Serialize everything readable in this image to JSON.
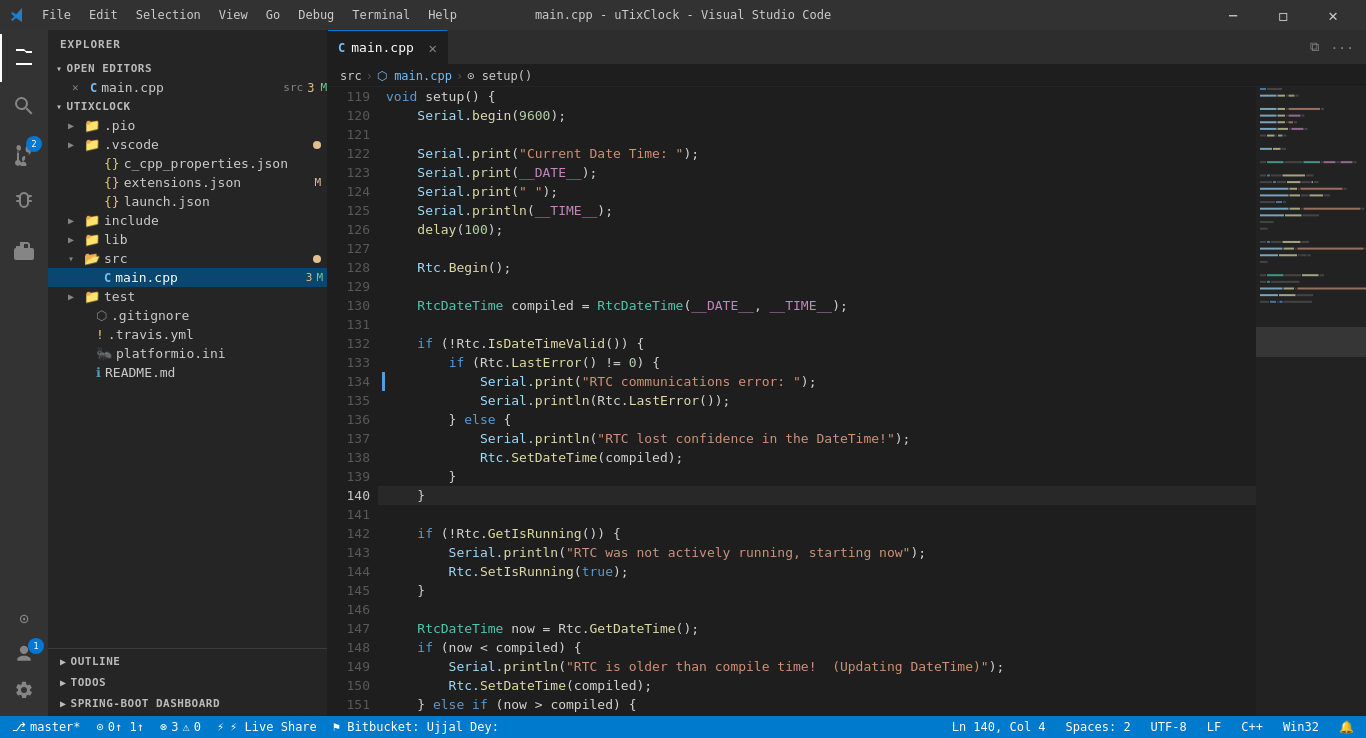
{
  "titleBar": {
    "title": "main.cpp - uTixClock - Visual Studio Code",
    "menuItems": [
      "File",
      "Edit",
      "Selection",
      "View",
      "Go",
      "Debug",
      "Terminal",
      "Help"
    ],
    "controls": [
      "minimize",
      "restore",
      "close"
    ]
  },
  "activityBar": {
    "items": [
      {
        "name": "explorer",
        "icon": "⎘",
        "active": true
      },
      {
        "name": "search",
        "icon": "🔍"
      },
      {
        "name": "source-control",
        "icon": "⑂",
        "badge": "2"
      },
      {
        "name": "debug",
        "icon": "▷"
      },
      {
        "name": "extensions",
        "icon": "⊞"
      }
    ],
    "bottomItems": [
      {
        "name": "remote-explorer",
        "icon": "⊙"
      },
      {
        "name": "accounts",
        "icon": "👤",
        "badge": "1"
      },
      {
        "name": "settings",
        "icon": "⚙"
      }
    ]
  },
  "sidebar": {
    "title": "EXPLORER",
    "sections": {
      "openEditors": {
        "label": "OPEN EDITORS",
        "items": [
          {
            "name": "main.cpp",
            "icon": "C",
            "iconColor": "#75bef8",
            "path": "src",
            "badge": "3",
            "badgeLabel": "M",
            "modified": true
          }
        ]
      },
      "project": {
        "label": "UTIXCLOCK",
        "items": [
          {
            "name": ".pio",
            "type": "folder",
            "indent": 1
          },
          {
            "name": ".vscode",
            "type": "folder",
            "indent": 1,
            "dot": true,
            "dotColor": "#e2c08d"
          },
          {
            "name": "c_cpp_properties.json",
            "type": "json",
            "indent": 2
          },
          {
            "name": "extensions.json",
            "type": "json",
            "indent": 2,
            "badge": "M"
          },
          {
            "name": "launch.json",
            "type": "json",
            "indent": 2
          },
          {
            "name": "include",
            "type": "folder",
            "indent": 1
          },
          {
            "name": "lib",
            "type": "folder",
            "indent": 1
          },
          {
            "name": "src",
            "type": "folder",
            "indent": 1,
            "dot": true,
            "dotColor": "#e2c08d"
          },
          {
            "name": "main.cpp",
            "type": "cpp",
            "indent": 2,
            "badge": "3",
            "badgeLabel": "M",
            "modified": true,
            "active": true
          },
          {
            "name": "test",
            "type": "folder",
            "indent": 1
          },
          {
            "name": ".gitignore",
            "type": "file",
            "indent": 1
          },
          {
            "name": ".travis.yml",
            "type": "yaml",
            "indent": 1
          },
          {
            "name": "platformio.ini",
            "type": "ini",
            "indent": 1
          },
          {
            "name": "README.md",
            "type": "md",
            "indent": 1
          }
        ]
      }
    },
    "bottomSections": [
      "OUTLINE",
      "TODOS",
      "SPRING-BOOT DASHBOARD"
    ]
  },
  "tabs": [
    {
      "name": "main.cpp",
      "icon": "C",
      "iconColor": "#75bef8",
      "active": true,
      "modified": false
    }
  ],
  "breadcrumb": {
    "items": [
      "src",
      "main.cpp",
      "setup()"
    ]
  },
  "editor": {
    "lines": [
      {
        "num": 119,
        "content": "void setup() {",
        "tokens": [
          {
            "text": "void",
            "class": "kw"
          },
          {
            "text": " setup() {",
            "class": "op"
          }
        ]
      },
      {
        "num": 120,
        "content": "    Serial.begin(9600);",
        "tokens": [
          {
            "text": "    Serial.",
            "class": "var"
          },
          {
            "text": "begin",
            "class": "fn"
          },
          {
            "text": "(",
            "class": "op"
          },
          {
            "text": "9600",
            "class": "num"
          },
          {
            "text": ");",
            "class": "op"
          }
        ]
      },
      {
        "num": 121,
        "content": ""
      },
      {
        "num": 122,
        "content": "    Serial.print(\"Current Date Time: \");",
        "tokens": [
          {
            "text": "    Serial.",
            "class": "var"
          },
          {
            "text": "print",
            "class": "fn"
          },
          {
            "text": "(",
            "class": "op"
          },
          {
            "text": "\"Current Date Time: \"",
            "class": "str"
          },
          {
            "text": ");",
            "class": "op"
          }
        ]
      },
      {
        "num": 123,
        "content": "    Serial.print(__DATE__);",
        "tokens": [
          {
            "text": "    Serial.",
            "class": "var"
          },
          {
            "text": "print",
            "class": "fn"
          },
          {
            "text": "(",
            "class": "op"
          },
          {
            "text": "__DATE__",
            "class": "macro"
          },
          {
            "text": ");",
            "class": "op"
          }
        ]
      },
      {
        "num": 124,
        "content": "    Serial.print(\" \");",
        "tokens": [
          {
            "text": "    Serial.",
            "class": "var"
          },
          {
            "text": "print",
            "class": "fn"
          },
          {
            "text": "(",
            "class": "op"
          },
          {
            "text": "\" \"",
            "class": "str"
          },
          {
            "text": ");",
            "class": "op"
          }
        ]
      },
      {
        "num": 125,
        "content": "    Serial.println(__TIME__);",
        "tokens": [
          {
            "text": "    Serial.",
            "class": "var"
          },
          {
            "text": "println",
            "class": "fn"
          },
          {
            "text": "(",
            "class": "op"
          },
          {
            "text": "__TIME__",
            "class": "macro"
          },
          {
            "text": ");",
            "class": "op"
          }
        ]
      },
      {
        "num": 126,
        "content": "    delay(100);",
        "tokens": [
          {
            "text": "    ",
            "class": ""
          },
          {
            "text": "delay",
            "class": "fn"
          },
          {
            "text": "(",
            "class": "op"
          },
          {
            "text": "100",
            "class": "num"
          },
          {
            "text": ");",
            "class": "op"
          }
        ]
      },
      {
        "num": 127,
        "content": ""
      },
      {
        "num": 128,
        "content": "    Rtc.Begin();",
        "tokens": [
          {
            "text": "    Rtc.",
            "class": "var"
          },
          {
            "text": "Begin",
            "class": "fn"
          },
          {
            "text": "();",
            "class": "op"
          }
        ]
      },
      {
        "num": 129,
        "content": ""
      },
      {
        "num": 130,
        "content": "    RtcDateTime compiled = RtcDateTime(__DATE__, __TIME__);",
        "tokens": [
          {
            "text": "    ",
            "class": ""
          },
          {
            "text": "RtcDateTime",
            "class": "type"
          },
          {
            "text": " compiled = ",
            "class": "op"
          },
          {
            "text": "RtcDateTime",
            "class": "type"
          },
          {
            "text": "(",
            "class": "op"
          },
          {
            "text": "__DATE__",
            "class": "macro"
          },
          {
            "text": ", ",
            "class": "op"
          },
          {
            "text": "__TIME__",
            "class": "macro"
          },
          {
            "text": ");",
            "class": "op"
          }
        ]
      },
      {
        "num": 131,
        "content": ""
      },
      {
        "num": 132,
        "content": "    if (!Rtc.IsDateTimeValid()) {",
        "tokens": [
          {
            "text": "    ",
            "class": ""
          },
          {
            "text": "if",
            "class": "kw"
          },
          {
            "text": " (!Rtc.",
            "class": "op"
          },
          {
            "text": "IsDateTimeValid",
            "class": "fn"
          },
          {
            "text": "()) {",
            "class": "op"
          }
        ]
      },
      {
        "num": 133,
        "content": "        if (Rtc.LastError() != 0) {",
        "tokens": [
          {
            "text": "        ",
            "class": ""
          },
          {
            "text": "if",
            "class": "kw"
          },
          {
            "text": " (Rtc.",
            "class": "op"
          },
          {
            "text": "LastError",
            "class": "fn"
          },
          {
            "text": "() != ",
            "class": "op"
          },
          {
            "text": "0",
            "class": "num"
          },
          {
            "text": ") {",
            "class": "op"
          }
        ]
      },
      {
        "num": 134,
        "content": "            Serial.print(\"RTC communications error: \");",
        "tokens": [
          {
            "text": "            Serial.",
            "class": "var"
          },
          {
            "text": "print",
            "class": "fn"
          },
          {
            "text": "(",
            "class": "op"
          },
          {
            "text": "\"RTC communications error: \"",
            "class": "str"
          },
          {
            "text": ");",
            "class": "op"
          }
        ],
        "hasIndicator": true
      },
      {
        "num": 135,
        "content": "            Serial.println(Rtc.LastError());",
        "tokens": [
          {
            "text": "            Serial.",
            "class": "var"
          },
          {
            "text": "println",
            "class": "fn"
          },
          {
            "text": "(Rtc.",
            "class": "op"
          },
          {
            "text": "LastError",
            "class": "fn"
          },
          {
            "text": "());",
            "class": "op"
          }
        ]
      },
      {
        "num": 136,
        "content": "        } else {",
        "tokens": [
          {
            "text": "        } ",
            "class": "op"
          },
          {
            "text": "else",
            "class": "kw"
          },
          {
            "text": " {",
            "class": "op"
          }
        ]
      },
      {
        "num": 137,
        "content": "            Serial.println(\"RTC lost confidence in the DateTime!\");",
        "tokens": [
          {
            "text": "            Serial.",
            "class": "var"
          },
          {
            "text": "println",
            "class": "fn"
          },
          {
            "text": "(",
            "class": "op"
          },
          {
            "text": "\"RTC lost confidence in the DateTime!\"",
            "class": "str"
          },
          {
            "text": ");",
            "class": "op"
          }
        ]
      },
      {
        "num": 138,
        "content": "            Rtc.SetDateTime(compiled);",
        "tokens": [
          {
            "text": "            Rtc.",
            "class": "var"
          },
          {
            "text": "SetDateTime",
            "class": "fn"
          },
          {
            "text": "(compiled);",
            "class": "op"
          }
        ]
      },
      {
        "num": 139,
        "content": "        }",
        "tokens": [
          {
            "text": "        }",
            "class": "op"
          }
        ]
      },
      {
        "num": 140,
        "content": "    }",
        "tokens": [
          {
            "text": "    }",
            "class": "op"
          }
        ],
        "current": true
      },
      {
        "num": 141,
        "content": ""
      },
      {
        "num": 142,
        "content": "    if (!Rtc.GetIsRunning()) {",
        "tokens": [
          {
            "text": "    ",
            "class": ""
          },
          {
            "text": "if",
            "class": "kw"
          },
          {
            "text": " (!Rtc.",
            "class": "op"
          },
          {
            "text": "GetIsRunning",
            "class": "fn"
          },
          {
            "text": "()) {",
            "class": "op"
          }
        ]
      },
      {
        "num": 143,
        "content": "        Serial.println(\"RTC was not actively running, starting now\");",
        "tokens": [
          {
            "text": "        Serial.",
            "class": "var"
          },
          {
            "text": "println",
            "class": "fn"
          },
          {
            "text": "(",
            "class": "op"
          },
          {
            "text": "\"RTC was not actively running, starting now\"",
            "class": "str"
          },
          {
            "text": ");",
            "class": "op"
          }
        ]
      },
      {
        "num": 144,
        "content": "        Rtc.SetIsRunning(true);",
        "tokens": [
          {
            "text": "        Rtc.",
            "class": "var"
          },
          {
            "text": "SetIsRunning",
            "class": "fn"
          },
          {
            "text": "(",
            "class": "op"
          },
          {
            "text": "true",
            "class": "bool-val"
          },
          {
            "text": ");",
            "class": "op"
          }
        ]
      },
      {
        "num": 145,
        "content": "    }",
        "tokens": [
          {
            "text": "    }",
            "class": "op"
          }
        ]
      },
      {
        "num": 146,
        "content": ""
      },
      {
        "num": 147,
        "content": "    RtcDateTime now = Rtc.GetDateTime();",
        "tokens": [
          {
            "text": "    ",
            "class": ""
          },
          {
            "text": "RtcDateTime",
            "class": "type"
          },
          {
            "text": " now = Rtc.",
            "class": "op"
          },
          {
            "text": "GetDateTime",
            "class": "fn"
          },
          {
            "text": "();",
            "class": "op"
          }
        ]
      },
      {
        "num": 148,
        "content": "    if (now < compiled) {",
        "tokens": [
          {
            "text": "    ",
            "class": ""
          },
          {
            "text": "if",
            "class": "kw"
          },
          {
            "text": " (now < compiled) {",
            "class": "op"
          }
        ]
      },
      {
        "num": 149,
        "content": "        Serial.println(\"RTC is older than compile time!  (Updating DateTime)\");",
        "tokens": [
          {
            "text": "        Serial.",
            "class": "var"
          },
          {
            "text": "println",
            "class": "fn"
          },
          {
            "text": "(",
            "class": "op"
          },
          {
            "text": "\"RTC is older than compile time!  (Updating DateTime)\"",
            "class": "str"
          },
          {
            "text": ");",
            "class": "op"
          }
        ]
      },
      {
        "num": 150,
        "content": "        Rtc.SetDateTime(compiled);",
        "tokens": [
          {
            "text": "        Rtc.",
            "class": "var"
          },
          {
            "text": "SetDateTime",
            "class": "fn"
          },
          {
            "text": "(compiled);",
            "class": "op"
          }
        ]
      },
      {
        "num": 151,
        "content": "    } else if (now > compiled) {",
        "tokens": [
          {
            "text": "    } ",
            "class": "op"
          },
          {
            "text": "else",
            "class": "kw"
          },
          {
            "text": " ",
            "class": ""
          },
          {
            "text": "if",
            "class": "kw"
          },
          {
            "text": " (now > compiled) {",
            "class": "op"
          }
        ]
      }
    ]
  },
  "statusBar": {
    "left": [
      {
        "text": "⎇ master*",
        "name": "branch"
      },
      {
        "text": "⊙ 0↑ 1↑",
        "name": "sync"
      },
      {
        "text": "⊗ 3 ⚠ 0",
        "name": "errors"
      },
      {
        "text": "",
        "name": "debug-indicator"
      }
    ],
    "right": [
      {
        "text": "Ln 140, Col 4",
        "name": "cursor-position"
      },
      {
        "text": "Spaces: 2",
        "name": "indentation"
      },
      {
        "text": "UTF-8",
        "name": "encoding"
      },
      {
        "text": "LF",
        "name": "line-ending"
      },
      {
        "text": "C++",
        "name": "language"
      },
      {
        "text": "Win32",
        "name": "platform"
      },
      {
        "text": "🔔",
        "name": "notifications"
      }
    ],
    "liveShare": "⚡ Live Share",
    "bitbucket": "⚑ Bitbucket: Ujjal Dey:"
  }
}
